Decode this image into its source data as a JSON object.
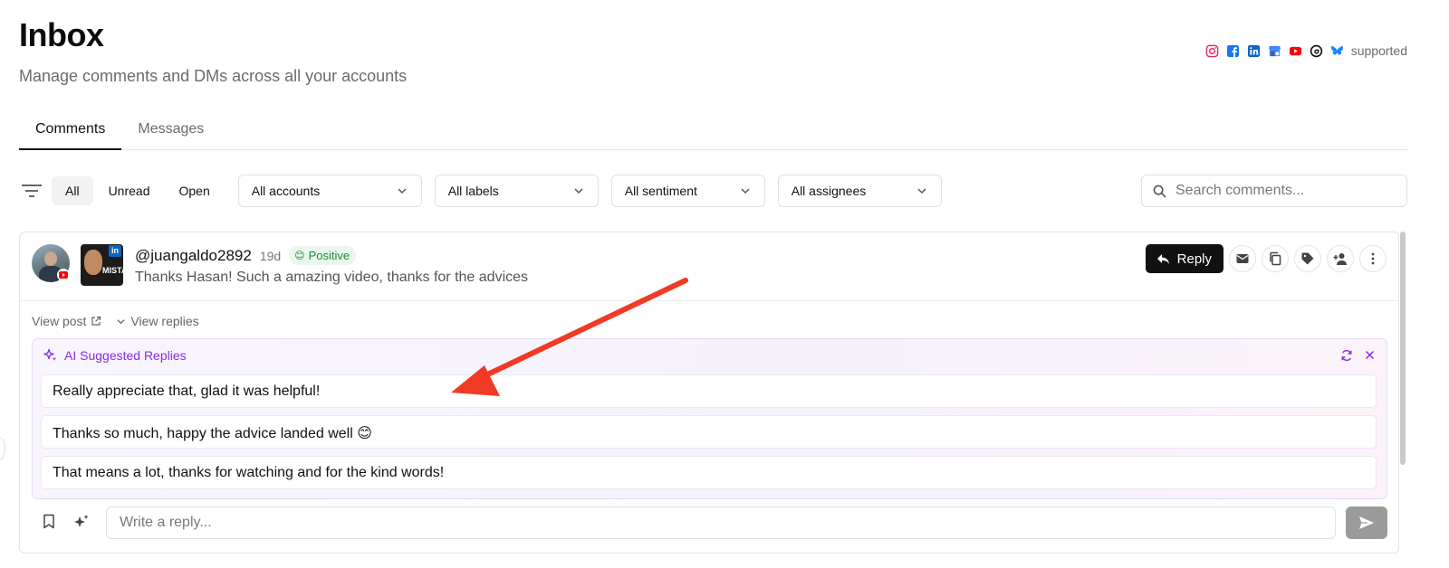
{
  "header": {
    "title": "Inbox",
    "subtitle": "Manage comments and DMs across all your accounts",
    "supported_label": "supported",
    "platforms": [
      "instagram-icon",
      "facebook-icon",
      "linkedin-icon",
      "google-business-icon",
      "youtube-icon",
      "threads-icon",
      "bluesky-icon"
    ]
  },
  "tabs": [
    {
      "label": "Comments",
      "active": true
    },
    {
      "label": "Messages",
      "active": false
    }
  ],
  "filters": {
    "pills": [
      {
        "label": "All",
        "active": true
      },
      {
        "label": "Unread",
        "active": false
      },
      {
        "label": "Open",
        "active": false
      }
    ],
    "accounts": "All accounts",
    "labels": "All labels",
    "sentiment": "All sentiment",
    "assignees": "All assignees",
    "search_placeholder": "Search comments..."
  },
  "comment": {
    "username": "@juangaldo2892",
    "age": "19d",
    "sentiment": "Positive",
    "sentiment_emoji": "😊",
    "text": "Thanks Hasan! Such a amazing video, thanks for the advices",
    "thumbnail_text": "MISTA",
    "thumbnail_badge": "in",
    "reply_label": "Reply",
    "view_post": "View post",
    "view_replies": "View replies"
  },
  "ai": {
    "title": "AI Suggested Replies",
    "suggestions": [
      "Really appreciate that, glad it was helpful!",
      "Thanks so much, happy the advice landed well 😊",
      "That means a lot, thanks for watching and for the kind words!"
    ]
  },
  "composer": {
    "placeholder": "Write a reply..."
  },
  "colors": {
    "accent_purple": "#8a2be2",
    "annotation_red": "#f03a24",
    "positive_green": "#1f8a3a",
    "primary_button": "#111111"
  }
}
